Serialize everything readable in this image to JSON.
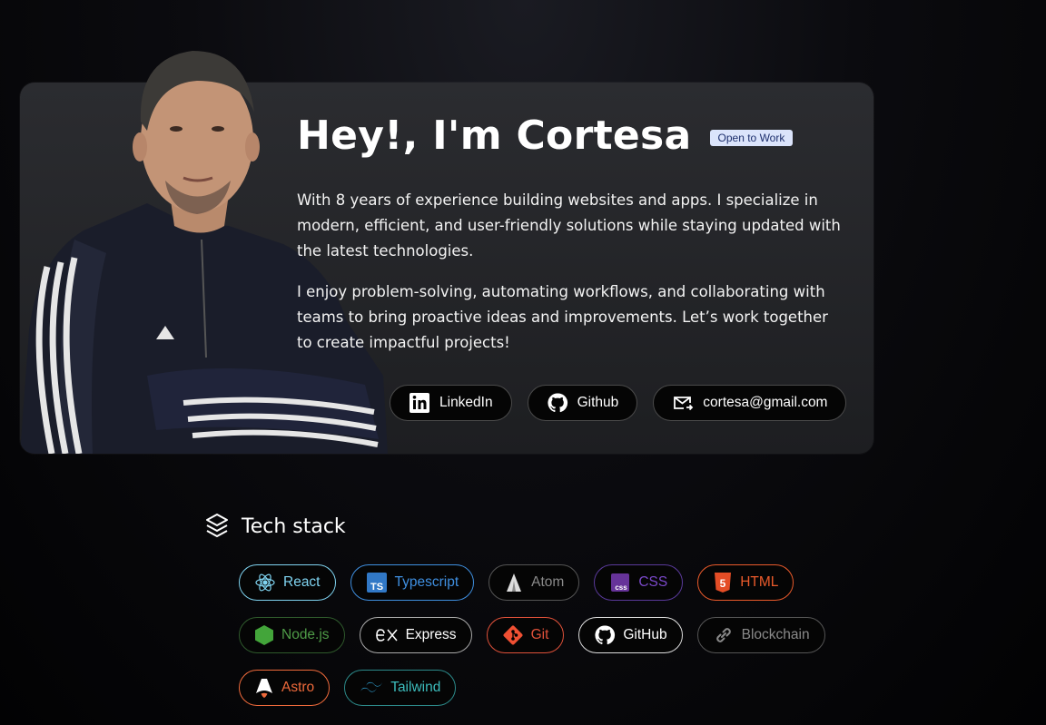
{
  "hero": {
    "headline": "Hey!, I'm Cortesa",
    "status_badge": "Open to Work",
    "bio_paragraph_1": "With 8 years of experience building websites and apps. I specialize in modern, efficient, and user-friendly solutions while staying updated with the latest technologies.",
    "bio_paragraph_2": "I enjoy problem-solving, automating workflows, and collaborating with teams to bring proactive ideas and improvements. Let’s work together to create impactful projects!",
    "contacts": [
      {
        "label": "LinkedIn",
        "icon": "linkedin-icon"
      },
      {
        "label": "Github",
        "icon": "github-icon"
      },
      {
        "label": "cortesa@gmail.com",
        "icon": "mail-icon"
      }
    ]
  },
  "tech_stack": {
    "title": "Tech stack",
    "icon": "layers-icon",
    "items": [
      {
        "label": "React",
        "icon": "react-icon",
        "color": "#7fd3f0"
      },
      {
        "label": "Typescript",
        "icon": "typescript-icon",
        "color": "#3f8fe0"
      },
      {
        "label": "Atom",
        "icon": "atom-icon",
        "color": "#8a8a8a"
      },
      {
        "label": "CSS",
        "icon": "css-icon",
        "color": "#7a48c9"
      },
      {
        "label": "HTML",
        "icon": "html-icon",
        "color": "#ea5a2b"
      },
      {
        "label": "Node.js",
        "icon": "nodejs-icon",
        "color": "#4e9b47"
      },
      {
        "label": "Express",
        "icon": "express-icon",
        "color": "#ffffff"
      },
      {
        "label": "Git",
        "icon": "git-icon",
        "color": "#e0513a"
      },
      {
        "label": "GitHub",
        "icon": "github-icon",
        "color": "#ffffff"
      },
      {
        "label": "Blockchain",
        "icon": "chain-link-icon",
        "color": "#8a8a8a"
      },
      {
        "label": "Astro",
        "icon": "astro-icon",
        "color": "#ef6a3b"
      },
      {
        "label": "Tailwind",
        "icon": "tailwind-icon",
        "color": "#3cbcbc"
      }
    ]
  }
}
